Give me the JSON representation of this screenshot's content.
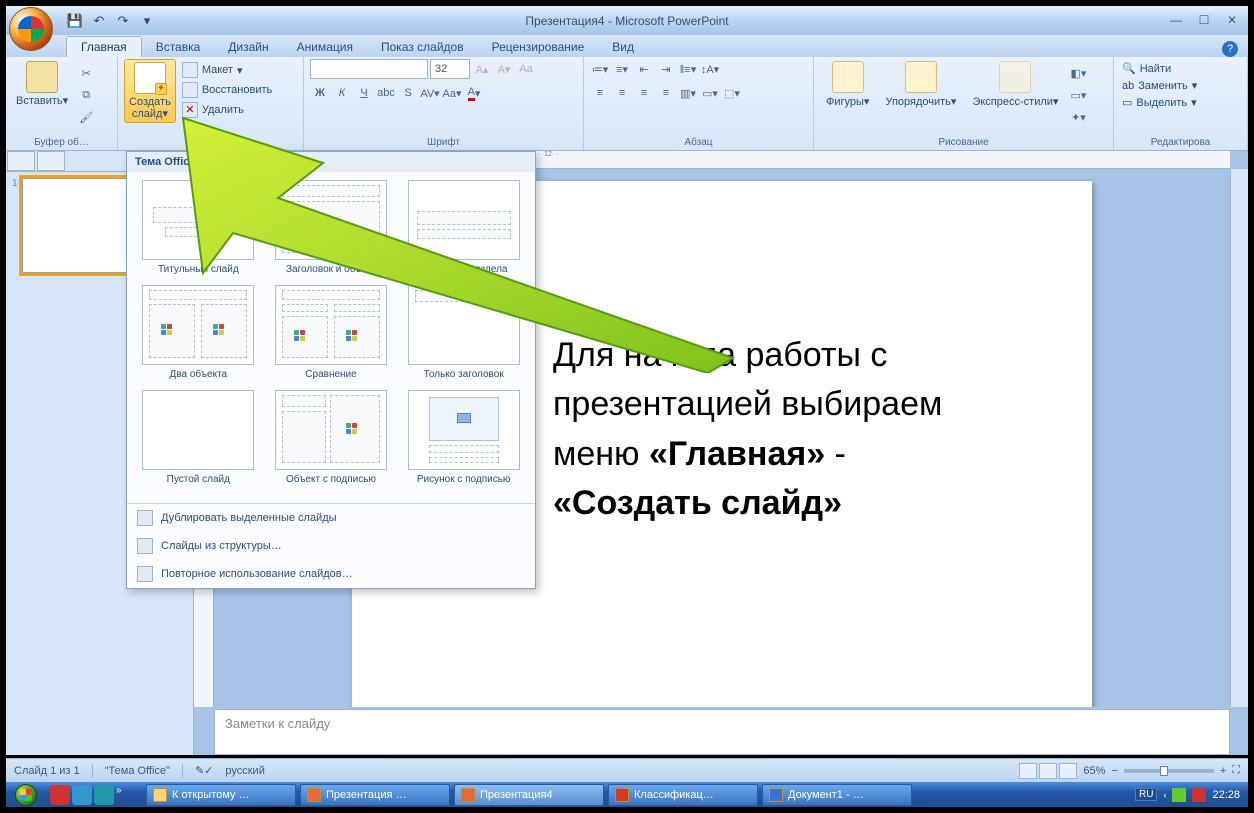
{
  "window": {
    "title": "Презентация4 - Microsoft PowerPoint"
  },
  "qat": {
    "save": "💾",
    "undo": "↶",
    "redo": "↷",
    "more": "▾"
  },
  "tabs": [
    "Главная",
    "Вставка",
    "Дизайн",
    "Анимация",
    "Показ слайдов",
    "Рецензирование",
    "Вид"
  ],
  "ribbon": {
    "clipboard": {
      "paste": "Вставить",
      "label": "Буфер об…",
      "dd": "▾"
    },
    "slides": {
      "new_slide": "Создать\nслайд",
      "layout": "Макет",
      "reset": "Восстановить",
      "delete": "Удалить",
      "label": "Слайды",
      "dd": "▾"
    },
    "font": {
      "size": "32",
      "combo_placeholder": "",
      "label": "Шрифт"
    },
    "paragraph": {
      "label": "Абзац"
    },
    "drawing": {
      "shapes": "Фигуры",
      "arrange": "Упорядочить",
      "quickstyles": "Экспресс-стили",
      "label": "Рисование"
    },
    "editing": {
      "find": "Найти",
      "replace": "Заменить",
      "select": "Выделить",
      "label": "Редактирова"
    }
  },
  "layout_popup": {
    "header": "Тема Office",
    "layouts": [
      "Титульный слайд",
      "Заголовок и объект",
      "Заголовок раздела",
      "Два объекта",
      "Сравнение",
      "Только заголовок",
      "Пустой слайд",
      "Объект с подписью",
      "Рисунок с подписью"
    ],
    "commands": [
      "Дублировать выделенные слайды",
      "Слайды из структуры…",
      "Повторное использование слайдов…"
    ]
  },
  "thumbs": {
    "n1": "1"
  },
  "notes_placeholder": "Заметки к слайду",
  "instruction": {
    "l1": "Для начала работы с",
    "l2": "презентацией выбираем",
    "l3": "меню ",
    "b1": "«Главная»",
    "dash": " - ",
    "b2": "«Создать слайд»"
  },
  "ruler": "· · ·1· · 8· · · 1 · · 6· · · 1 · · 4· · · 1 · · 2· · · 1 · · 0· · · 1 · · 2· · · 1 · · 4· · · 1 · · 6· · · 1 · · 8· · · 1 · ·10· · 1 · ·12· ·",
  "status": {
    "slide": "Слайд 1 из 1",
    "theme": "\"Тема Office\"",
    "lang": "русский",
    "zoom": "65%"
  },
  "taskbar": {
    "items": [
      {
        "label": "К открытому …",
        "icon": "#ffd37a"
      },
      {
        "label": "Презентация …",
        "icon": "#e46a3a"
      },
      {
        "label": "Презентация4",
        "icon": "#e46a3a",
        "active": true
      },
      {
        "label": "Классификац…",
        "icon": "#d43a2a"
      },
      {
        "label": "Документ1 - …",
        "icon": "#3a74d4"
      }
    ],
    "lang": "RU",
    "time": "22:28"
  }
}
